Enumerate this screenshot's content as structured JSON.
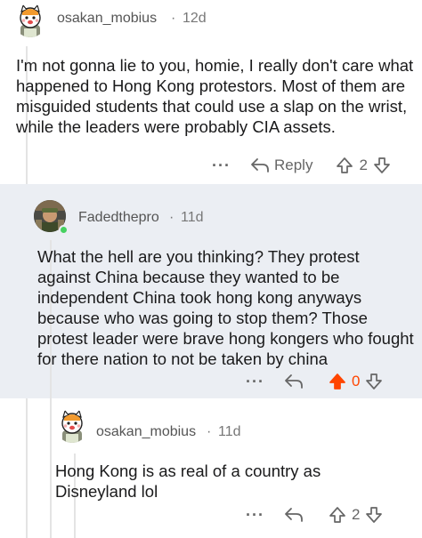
{
  "comments": [
    {
      "username": "osakan_mobius",
      "age": "12d",
      "body": "I'm not gonna lie to you, homie, I really don't care what happened to Hong Kong protestors. Most of them are misguided students that could use a slap on the wrist, while the leaders were probably CIA assets.",
      "reply_label": "Reply",
      "score": "2",
      "upvoted": false
    },
    {
      "username": "Fadedthepro",
      "age": "11d",
      "body": "What the hell are you thinking? They protest against China because they wanted to be independent China took hong kong anyways because who was going to stop them? Those protest leader were brave hong kongers who fought for there nation to not be taken by china",
      "score": "0",
      "upvoted": true,
      "online": true
    },
    {
      "username": "osakan_mobius",
      "age": "11d",
      "body": "Hong Kong is as real of a country as Disneyland lol",
      "score": "2",
      "upvoted": false
    }
  ],
  "separator": "·",
  "more_symbol": "···",
  "colors": {
    "upvote_active": "#ff4500",
    "highlight_bg": "#ebeef3",
    "online": "#46d160"
  }
}
